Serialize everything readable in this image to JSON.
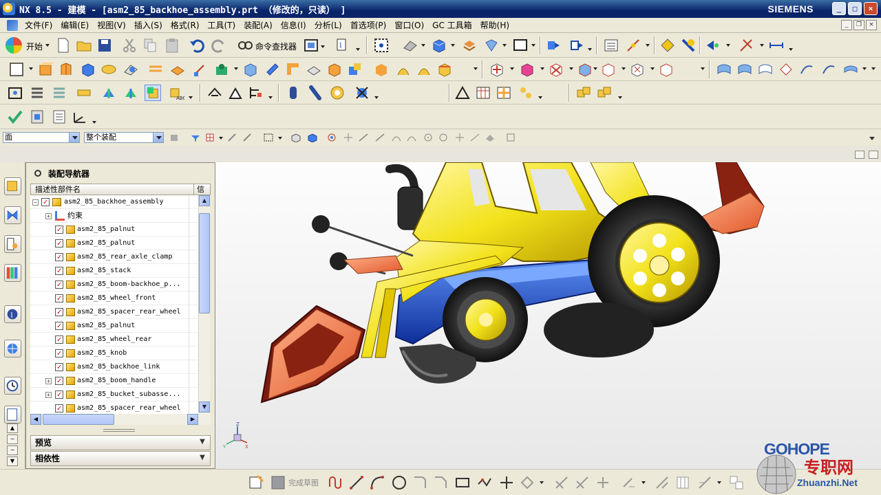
{
  "window": {
    "title": "NX 8.5 - 建模 - [asm2_85_backhoe_assembly.prt （修改的，只读） ]",
    "brand": "SIEMENS",
    "controls": {
      "minimize": "_",
      "maximize": "□",
      "close": "×"
    }
  },
  "menu": {
    "items": [
      "文件(F)",
      "编辑(E)",
      "视图(V)",
      "插入(S)",
      "格式(R)",
      "工具(T)",
      "装配(A)",
      "信息(I)",
      "分析(L)",
      "首选项(P)",
      "窗口(O)",
      "GC 工具箱",
      "帮助(H)"
    ]
  },
  "toolbar": {
    "start_label": "开始",
    "command_finder_label": "命令查找器"
  },
  "selection_bar": {
    "filter_value": "面",
    "scope_value": "整个装配"
  },
  "navigator": {
    "title": "装配导航器",
    "columns": [
      "描述性部件名",
      "信息"
    ],
    "rows": [
      {
        "label": "asm2_85_backhoe_assembly",
        "level": 0,
        "expander": "-",
        "checked": true
      },
      {
        "label": "约束",
        "level": 1,
        "expander": "+",
        "checked": false,
        "constraint": true
      },
      {
        "label": "asm2_85_palnut",
        "level": 1,
        "expander": "",
        "checked": true
      },
      {
        "label": "asm2_85_palnut",
        "level": 1,
        "expander": "",
        "checked": true
      },
      {
        "label": "asm2_85_rear_axle_clamp",
        "level": 1,
        "expander": "",
        "checked": true
      },
      {
        "label": "asm2_85_stack",
        "level": 1,
        "expander": "",
        "checked": true
      },
      {
        "label": "asm2_85_boom-backhoe_p...",
        "level": 1,
        "expander": "",
        "checked": true
      },
      {
        "label": "asm2_85_wheel_front",
        "level": 1,
        "expander": "",
        "checked": true
      },
      {
        "label": "asm2_85_spacer_rear_wheel",
        "level": 1,
        "expander": "",
        "checked": true
      },
      {
        "label": "asm2_85_palnut",
        "level": 1,
        "expander": "",
        "checked": true
      },
      {
        "label": "asm2_85_wheel_rear",
        "level": 1,
        "expander": "",
        "checked": true
      },
      {
        "label": "asm2_85_knob",
        "level": 1,
        "expander": "",
        "checked": true
      },
      {
        "label": "asm2_85_backhoe_link",
        "level": 1,
        "expander": "",
        "checked": true
      },
      {
        "label": "asm2_85_boom_handle",
        "level": 1,
        "expander": "+",
        "checked": true
      },
      {
        "label": "asm2_85_bucket_subasse...",
        "level": 1,
        "expander": "+",
        "checked": true
      },
      {
        "label": "asm2_85_spacer_rear_wheel",
        "level": 1,
        "expander": "",
        "checked": true
      }
    ],
    "preview_label": "预览",
    "dependency_label": "相依性"
  },
  "sketch_bar": {
    "finish_sketch_label": "完成草图"
  },
  "watermark": {
    "line1": "GOHOPE",
    "line2": "专职网",
    "line3": "Zhuanzhi.Net"
  },
  "colors": {
    "title_bar": "#0a246a",
    "model_yellow": "#f2e21a",
    "model_blue": "#1f4fd6",
    "model_orange": "#f07a45",
    "model_red_dark": "#7a1a10"
  }
}
